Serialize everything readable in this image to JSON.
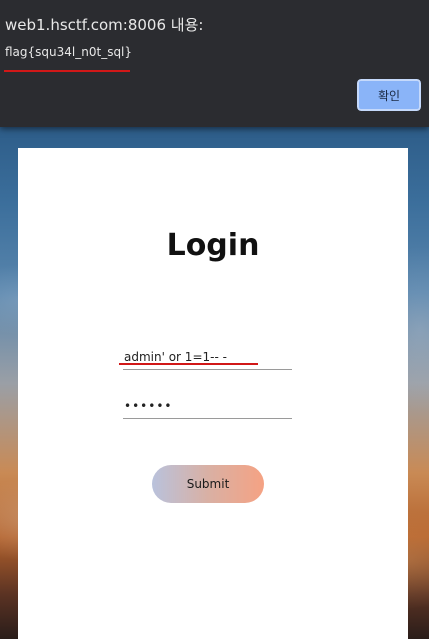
{
  "alert": {
    "origin_text": "web1.hsctf.com:8006 내용:",
    "message": "flag{squ34l_n0t_sql}",
    "ok_label": "확인"
  },
  "login": {
    "title": "Login",
    "username_value": "admin' or 1=1-- -",
    "password_value": "••••••",
    "submit_label": "Submit"
  },
  "colors": {
    "annotation_red": "#d11818",
    "dialog_bg": "#2b2c30",
    "ok_button": "#8ab4f8",
    "submit_gradient_start": "#b9c2dc",
    "submit_gradient_end": "#f5a283"
  }
}
